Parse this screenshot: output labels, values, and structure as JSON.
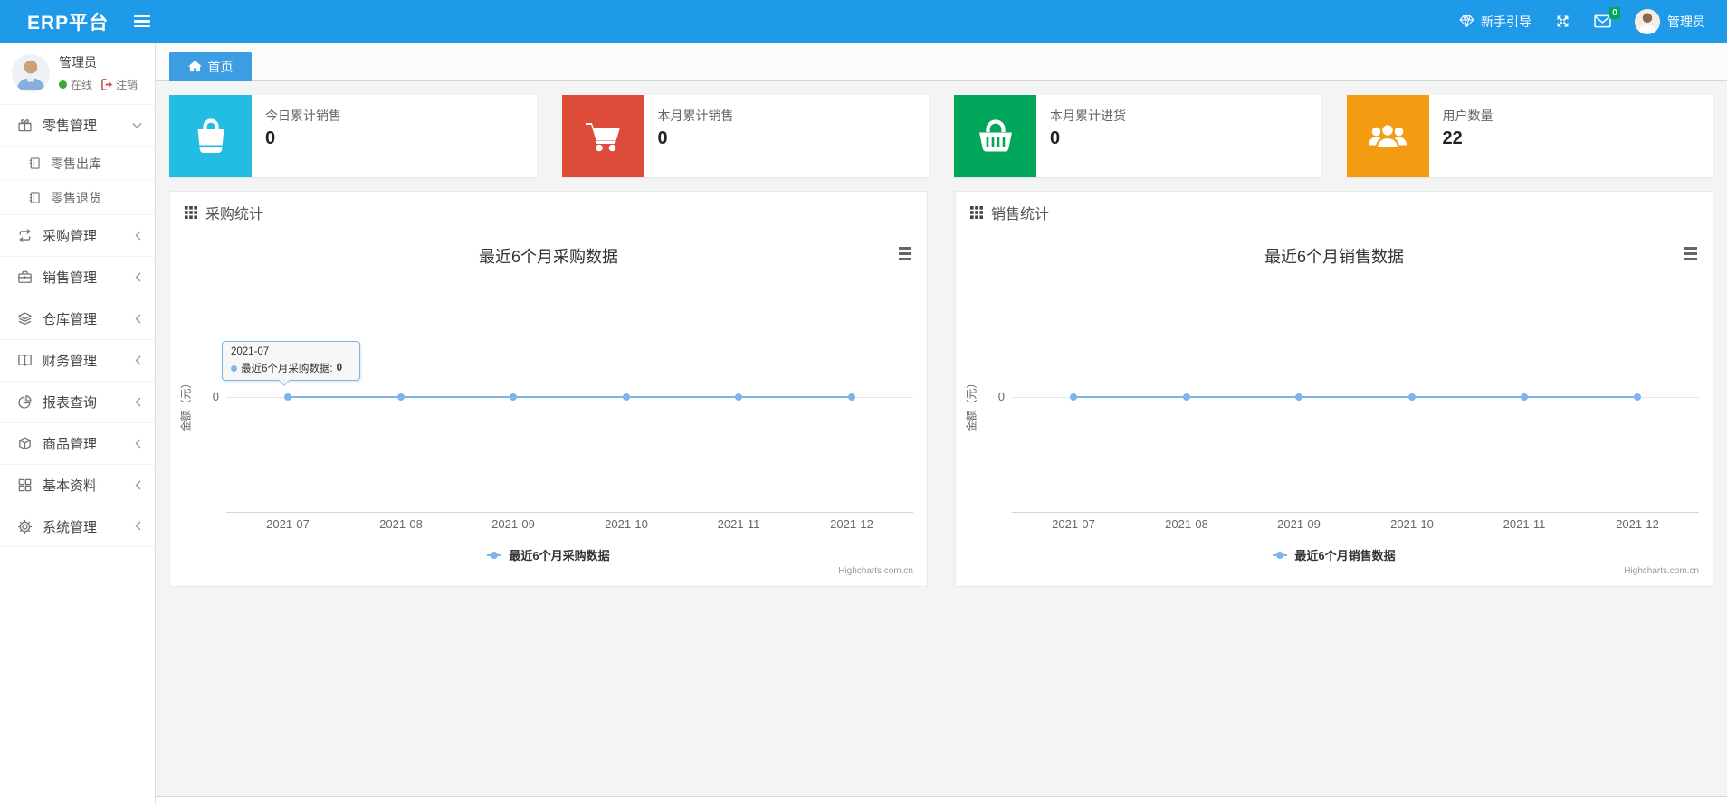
{
  "navbar": {
    "brand": "ERP平台",
    "guide": "新手引导",
    "messages_badge": "0",
    "username": "管理员",
    "accent_color": "#1f9ae8"
  },
  "sidebar": {
    "user": {
      "name": "管理员",
      "status": "在线",
      "logout": "注销"
    },
    "items": [
      {
        "label": "零售管理",
        "icon": "gift-icon",
        "state": "expanded",
        "children": [
          {
            "label": "零售出库",
            "icon": "notebook-icon"
          },
          {
            "label": "零售退货",
            "icon": "notebook-icon"
          }
        ]
      },
      {
        "label": "采购管理",
        "icon": "repeat-icon"
      },
      {
        "label": "销售管理",
        "icon": "briefcase-icon"
      },
      {
        "label": "仓库管理",
        "icon": "layers-icon"
      },
      {
        "label": "财务管理",
        "icon": "open-book-icon"
      },
      {
        "label": "报表查询",
        "icon": "pie-chart-icon"
      },
      {
        "label": "商品管理",
        "icon": "box-icon"
      },
      {
        "label": "基本资料",
        "icon": "grid-icon"
      },
      {
        "label": "系统管理",
        "icon": "gear-icon"
      }
    ]
  },
  "tabs": {
    "home": "首页"
  },
  "stats": [
    {
      "label": "今日累计销售",
      "value": "0",
      "color": "#23bde4",
      "icon": "shopping-bag-icon"
    },
    {
      "label": "本月累计销售",
      "value": "0",
      "color": "#dd4b39",
      "icon": "shopping-cart-icon"
    },
    {
      "label": "本月累计进货",
      "value": "0",
      "color": "#00a65a",
      "icon": "shopping-basket-icon"
    },
    {
      "label": "用户数量",
      "value": "22",
      "color": "#f39c12",
      "icon": "users-icon"
    }
  ],
  "panels": [
    {
      "title": "采购统计"
    },
    {
      "title": "销售统计"
    }
  ],
  "chart_data": [
    {
      "type": "line",
      "title": "最近6个月采购数据",
      "categories": [
        "2021-07",
        "2021-08",
        "2021-09",
        "2021-10",
        "2021-11",
        "2021-12"
      ],
      "series": [
        {
          "name": "最近6个月采购数据",
          "values": [
            0,
            0,
            0,
            0,
            0,
            0
          ],
          "color": "#7cb5ec"
        }
      ],
      "xlabel": "",
      "ylabel": "金额（元）",
      "yticks": [
        "0"
      ],
      "ylim": [
        0,
        0
      ],
      "grid": true,
      "legend_position": "bottom",
      "credits": "Highcharts.com.cn",
      "tooltip": {
        "header": "2021-07",
        "label": "最近6个月采购数据:",
        "value": "0"
      }
    },
    {
      "type": "line",
      "title": "最近6个月销售数据",
      "categories": [
        "2021-07",
        "2021-08",
        "2021-09",
        "2021-10",
        "2021-11",
        "2021-12"
      ],
      "series": [
        {
          "name": "最近6个月销售数据",
          "values": [
            0,
            0,
            0,
            0,
            0,
            0
          ],
          "color": "#7cb5ec"
        }
      ],
      "xlabel": "",
      "ylabel": "金额（元）",
      "yticks": [
        "0"
      ],
      "ylim": [
        0,
        0
      ],
      "grid": true,
      "legend_position": "bottom",
      "credits": "Highcharts.com.cn"
    }
  ]
}
